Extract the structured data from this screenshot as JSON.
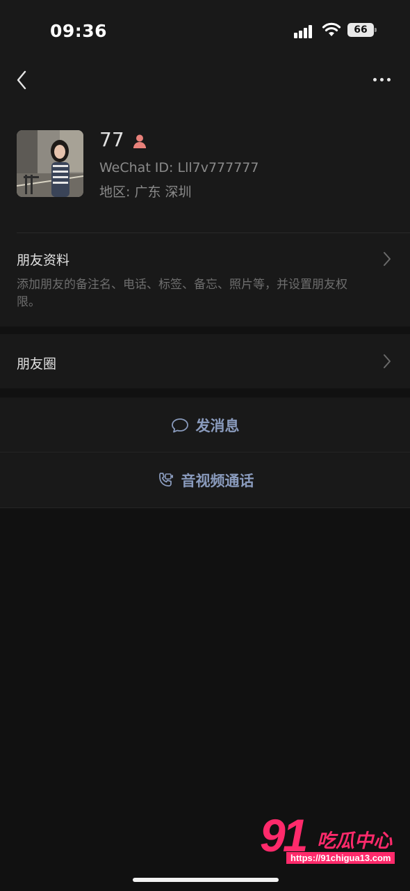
{
  "status_bar": {
    "time": "09:36",
    "battery": "66"
  },
  "profile": {
    "name": "77",
    "wechat_id": "WeChat ID: Lll7v777777",
    "region": "地区: 广东 深圳",
    "gender_icon": "female-person-icon",
    "gender_color": "#e8817a"
  },
  "friend_info": {
    "title": "朋友资料",
    "description": "添加朋友的备注名、电话、标签、备忘、照片等，并设置朋友权限。"
  },
  "moments": {
    "title": "朋友圈"
  },
  "actions": {
    "message_label": "发消息",
    "call_label": "音视频通话",
    "accent_color": "#8a9bbd"
  },
  "watermark": {
    "number": "91",
    "text": "吃瓜中心",
    "url": "https://91chigua13.com"
  }
}
